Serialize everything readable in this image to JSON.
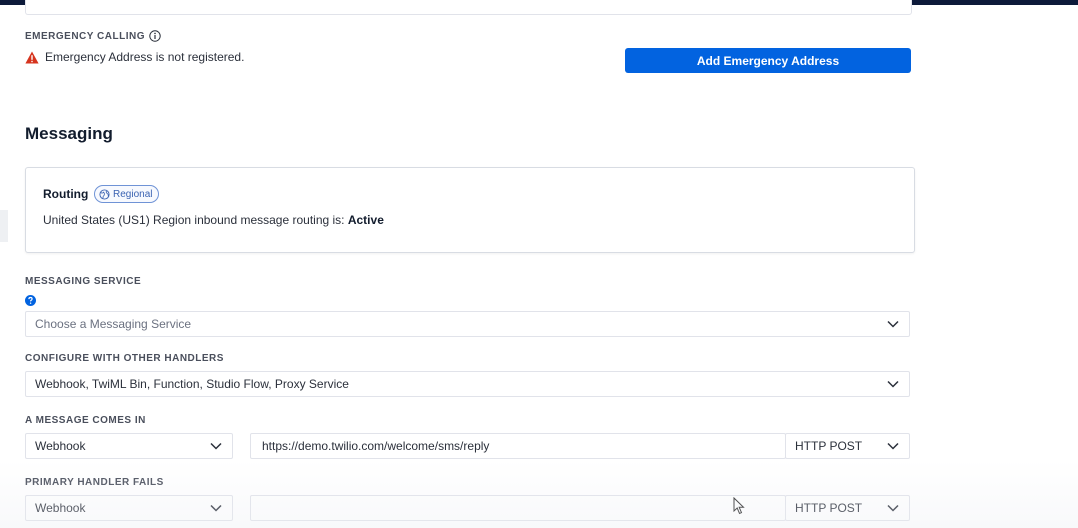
{
  "emergency": {
    "label": "EMERGENCY CALLING",
    "warning": "Emergency Address is not registered.",
    "add_button": "Add Emergency Address"
  },
  "messaging": {
    "heading": "Messaging",
    "routing": {
      "title": "Routing",
      "badge": "Regional",
      "status_prefix": "United States (US1) Region inbound message routing is: ",
      "status_value": "Active"
    },
    "messaging_service": {
      "label": "MESSAGING SERVICE",
      "placeholder": "Choose a Messaging Service"
    },
    "other_handlers": {
      "label": "CONFIGURE WITH OTHER HANDLERS",
      "value": "Webhook, TwiML Bin, Function, Studio Flow, Proxy Service"
    },
    "message_comes_in": {
      "label": "A MESSAGE COMES IN",
      "handler_type": "Webhook",
      "url": "https://demo.twilio.com/welcome/sms/reply",
      "method": "HTTP POST"
    },
    "primary_handler_fails": {
      "label": "PRIMARY HANDLER FAILS",
      "handler_type": "Webhook",
      "url": "",
      "method": "HTTP POST"
    }
  },
  "colors": {
    "primary_button": "#0263e0",
    "warning_icon": "#d6341e",
    "badge_border": "#6f93d6",
    "top_bar": "#0d1a3a"
  },
  "icons": {
    "info": "info-circle-icon",
    "warning": "warning-triangle-icon",
    "globe": "globe-icon",
    "help": "help-circle-icon",
    "chevron": "chevron-down-icon",
    "cursor": "mouse-pointer-icon"
  }
}
